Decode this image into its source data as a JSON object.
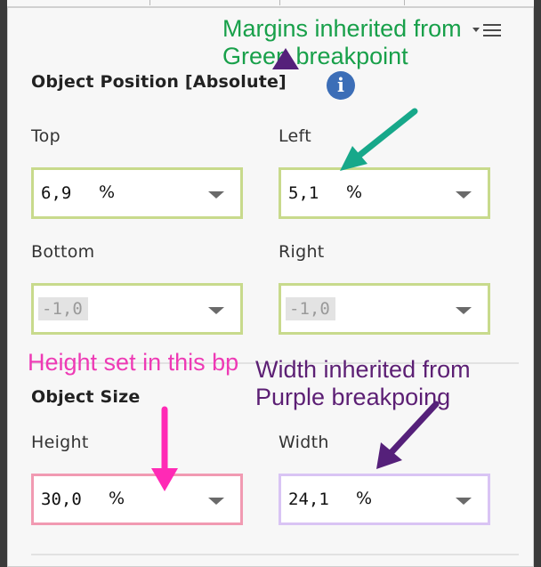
{
  "panel": {
    "menu_icon": "hamburger-menu-icon",
    "info_icon": "i",
    "position_section": {
      "title": "Object Position [Absolute]",
      "fields": [
        {
          "label": "Top",
          "value": "6,9",
          "unit": "%",
          "disabled": false
        },
        {
          "label": "Left",
          "value": "5,1",
          "unit": "%",
          "disabled": false
        },
        {
          "label": "Bottom",
          "value": "-1,0",
          "unit": "",
          "disabled": true
        },
        {
          "label": "Right",
          "value": "-1,0",
          "unit": "",
          "disabled": true
        }
      ]
    },
    "size_section": {
      "title": "Object Size",
      "fields": [
        {
          "label": "Height",
          "value": "30,0",
          "unit": "%",
          "disabled": false
        },
        {
          "label": "Width",
          "value": "24,1",
          "unit": "%",
          "disabled": false
        }
      ]
    }
  },
  "annotations": {
    "margins_note": "Margins inherited from\nGreen breakpoint",
    "height_note": "Height set in this bp",
    "width_note": "Width inherited from\nPurple breakpoing"
  },
  "colors": {
    "green_border": "#c8da8c",
    "pink_border": "#f19ab2",
    "lavender_border": "#d9c4f4",
    "green_text": "#18a04a",
    "magenta_text": "#ee3ab5",
    "purple_text": "#5c1f74",
    "teal_arrow": "#17a88a",
    "magenta_arrow": "#ff2ab5",
    "purple_arrow": "#55207a",
    "info_blue": "#3c6eb7"
  }
}
